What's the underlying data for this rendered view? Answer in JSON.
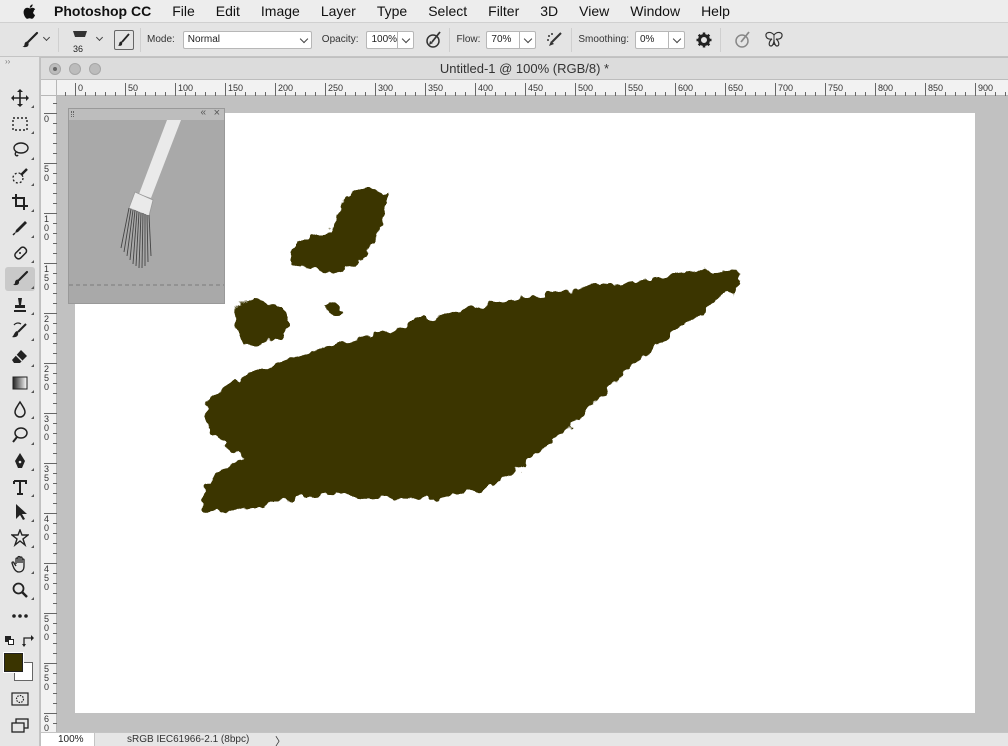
{
  "menubar": {
    "app_name": "Photoshop CC",
    "items": [
      "File",
      "Edit",
      "Image",
      "Layer",
      "Type",
      "Select",
      "Filter",
      "3D",
      "View",
      "Window",
      "Help"
    ]
  },
  "options": {
    "brush_size": "36",
    "mode_label": "Mode:",
    "mode_value": "Normal",
    "opacity_label": "Opacity:",
    "opacity_value": "100%",
    "flow_label": "Flow:",
    "flow_value": "70%",
    "smoothing_label": "Smoothing:",
    "smoothing_value": "0%"
  },
  "document": {
    "title": "Untitled-1 @ 100% (RGB/8) *",
    "zoom": "100%",
    "color_profile": "sRGB IEC61966-2.1 (8bpc)",
    "info_arrow": "〉"
  },
  "rulers": {
    "horizontal": [
      "0",
      "50",
      "100",
      "150",
      "200",
      "250",
      "300",
      "350",
      "400",
      "450",
      "500",
      "550",
      "600",
      "650",
      "700",
      "750",
      "800",
      "850",
      "900"
    ],
    "vertical": [
      "0",
      "5\n0",
      "1\n0\n0",
      "1\n5\n0",
      "2\n0\n0",
      "2\n5\n0",
      "3\n0\n0",
      "3\n5\n0",
      "4\n0\n0",
      "4\n5\n0",
      "5\n0\n0",
      "5\n5\n0",
      "6\n0"
    ]
  },
  "colors": {
    "foreground": "#3a3400",
    "background": "#ffffff",
    "stroke": "#3b3500"
  },
  "tools": [
    "move-tool",
    "marquee-tool",
    "lasso-tool",
    "quick-selection-tool",
    "crop-tool",
    "eyedropper-tool",
    "healing-brush-tool",
    "brush-tool",
    "clone-stamp-tool",
    "history-brush-tool",
    "eraser-tool",
    "gradient-tool",
    "blur-tool",
    "dodge-tool",
    "pen-tool",
    "type-tool",
    "path-selection-tool",
    "shape-tool",
    "hand-tool",
    "zoom-tool",
    "more-tools"
  ]
}
